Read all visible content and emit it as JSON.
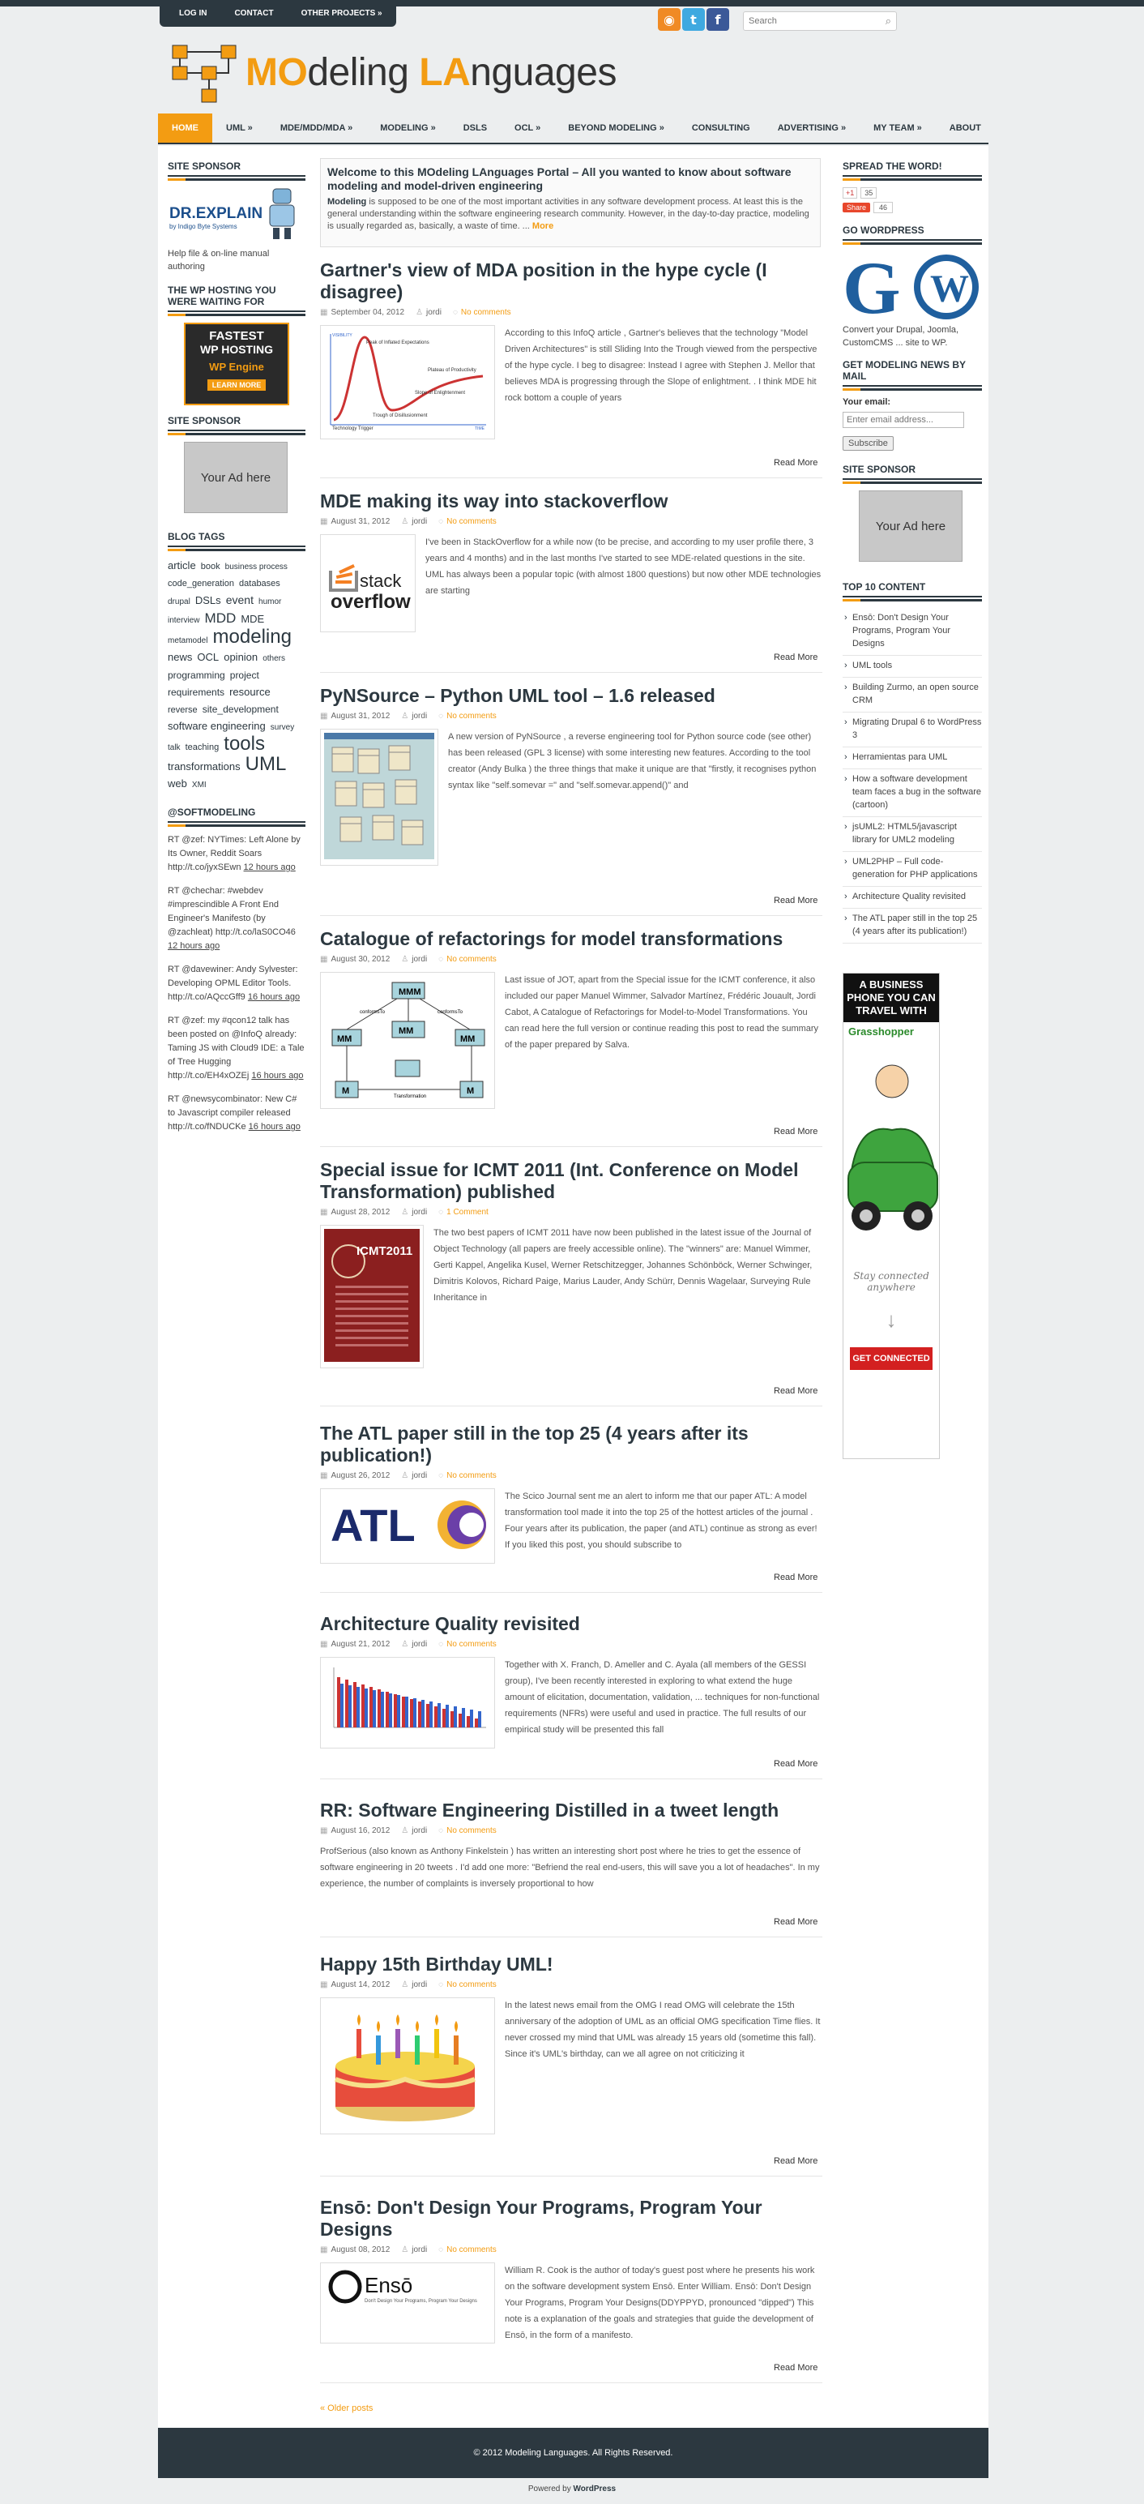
{
  "toplinks": [
    "LOG IN",
    "CONTACT",
    "OTHER PROJECTS »"
  ],
  "search": {
    "placeholder": "Search"
  },
  "logo": {
    "hl1": "MO",
    "rest1": "deling ",
    "hl2": "LA",
    "rest2": "nguages"
  },
  "nav": [
    "HOME",
    "UML »",
    "MDE/MDD/MDA »",
    "MODELING »",
    "DSLS",
    "OCL »",
    "BEYOND MODELING »",
    "CONSULTING",
    "ADVERTISING »",
    "MY TEAM »",
    "ABOUT"
  ],
  "left": {
    "sponsor_title": "SITE SPONSOR",
    "drexplain_name": "DR.EXPLAIN",
    "drexplain_by": "by Indigo Byte Systems",
    "drexplain_text": "Help file & on-line manual authoring",
    "wphosting_title": "THE WP HOSTING YOU WERE WAITING FOR",
    "wpengine_lines": [
      "FASTEST",
      "WP HOSTING",
      "WP Engine",
      "LEARN MORE"
    ],
    "sponsor2_title": "SITE SPONSOR",
    "ad_text": "Your Ad here",
    "tags_title": "BLOG TAGS",
    "tags": [
      {
        "t": "article",
        "s": 13
      },
      {
        "t": "book",
        "s": 11
      },
      {
        "t": "business process",
        "s": 10
      },
      {
        "t": "code_generation",
        "s": 11
      },
      {
        "t": "databases",
        "s": 11
      },
      {
        "t": "drupal",
        "s": 10
      },
      {
        "t": "DSLs",
        "s": 13
      },
      {
        "t": "event",
        "s": 14
      },
      {
        "t": "humor",
        "s": 10
      },
      {
        "t": "interview",
        "s": 10
      },
      {
        "t": "MDD",
        "s": 17
      },
      {
        "t": "MDE",
        "s": 13
      },
      {
        "t": "metamodel",
        "s": 10
      },
      {
        "t": "modeling",
        "s": 24
      },
      {
        "t": "news",
        "s": 13
      },
      {
        "t": "OCL",
        "s": 13
      },
      {
        "t": "opinion",
        "s": 13
      },
      {
        "t": "others",
        "s": 10
      },
      {
        "t": "programming",
        "s": 12
      },
      {
        "t": "project",
        "s": 12
      },
      {
        "t": "requirements",
        "s": 12
      },
      {
        "t": "resource",
        "s": 13
      },
      {
        "t": "reverse",
        "s": 11
      },
      {
        "t": "site_development",
        "s": 12
      },
      {
        "t": "software engineering",
        "s": 13
      },
      {
        "t": "survey",
        "s": 10
      },
      {
        "t": "talk",
        "s": 10
      },
      {
        "t": "teaching",
        "s": 11
      },
      {
        "t": "tools",
        "s": 24
      },
      {
        "t": "transformations",
        "s": 13
      },
      {
        "t": "UML",
        "s": 24
      },
      {
        "t": "web",
        "s": 13
      },
      {
        "t": "XMI",
        "s": 10
      }
    ],
    "tweets_title": "@SOFTMODELING",
    "tweets": [
      {
        "text": "RT @zef: NYTimes: Left Alone by Its Owner, Reddit Soars http://t.co/jyxSEwn ",
        "time": "12 hours ago"
      },
      {
        "text": "RT @chechar: #webdev #imprescindible A Front End Engineer's Manifesto (by @zachleat) http://t.co/laS0CO46 ",
        "time": "12 hours ago"
      },
      {
        "text": "RT @davewiner: Andy Sylvester: Developing OPML Editor Tools. http://t.co/AQccGff9 ",
        "time": "16 hours ago"
      },
      {
        "text": "RT @zef: my #qcon12 talk has been posted on @InfoQ already: Taming JS with Cloud9 IDE: a Tale of Tree Hugging http://t.co/EH4xOZEj ",
        "time": "16 hours ago"
      },
      {
        "text": "RT @newsycombinator: New C# to Javascript compiler released http://t.co/fNDUCKe ",
        "time": "16 hours ago"
      }
    ]
  },
  "welcome": {
    "title": "Welcome to this MOdeling LAnguages Portal – All you wanted to know about software modeling and model-driven engineering",
    "lead": "Modeling",
    "text": " is supposed to be one of the most important activities in any software development process. At least this is the general understanding within the software engineering research community. However, in the day-to-day practice, modeling is usually regarded as, basically, a waste of time. ... ",
    "more": "More"
  },
  "posts": [
    {
      "title": "Gartner's view of MDA position in the hype cycle (I disagree)",
      "date": "September 04, 2012",
      "author": "jordi",
      "comments": "No comments",
      "text": "According to this InfoQ article , Gartner's believes that the technology \"Model Driven Architectures\" is still Sliding Into the Trough viewed from the perspective of the hype cycle. I beg to disagree: Instead I agree with Stephen J. Mellor that believes MDA is progressing through the Slope of enlightment. . I think MDE hit rock bottom a couple of years",
      "read": "Read More",
      "thumb_labels": [
        "VISIBILITY",
        "Peak of Inflated Expectations",
        "Plateau of Productivity",
        "Slope of Enlightenment",
        "Trough of Disillusionment",
        "Technology Trigger",
        "TIME"
      ]
    },
    {
      "title": "MDE making its way into stackoverflow",
      "date": "August 31, 2012",
      "author": "jordi",
      "comments": "No comments",
      "text": "I've been in StackOverflow for a while now (to be precise, and according to my user profile there, 3 years and 4 months) and in the last months I've started to see MDE-related questions in the site. UML has always been a popular topic (with almost 1800 questions) but now other MDE technologies are starting",
      "read": "Read More",
      "thumb_labels": [
        "stack",
        "overflow"
      ]
    },
    {
      "title": "PyNSource – Python UML tool – 1.6 released",
      "date": "August 31, 2012",
      "author": "jordi",
      "comments": "No comments",
      "text": "A new version of PyNSource , a reverse engineering tool for Python source code (see other) has been released (GPL 3 license) with some interesting new features. According to the tool creator (Andy Bulka ) the three things that make it unique are that \"firstly, it recognises python syntax like \"self.somevar =\" and \"self.somevar.append()\" and",
      "read": "Read More",
      "thumb_labels": []
    },
    {
      "title": "Catalogue of refactorings for model transformations",
      "date": "August 30, 2012",
      "author": "jordi",
      "comments": "No comments",
      "text": "Last issue of JOT, apart from the Special issue for the ICMT conference, it also included our paper Manuel Wimmer, Salvador Martínez, Frédéric Jouault, Jordi Cabot, A Catalogue of Refactorings for Model-to-Model Transformations. You can read here the full version or continue reading this post to read the summary of the paper prepared by Salva.",
      "read": "Read More",
      "thumb_labels": [
        "MMM",
        "MM",
        "MM",
        "MM",
        "M",
        "M",
        "conformsTo",
        "conformsTo",
        "Transformation"
      ]
    },
    {
      "title": "Special issue for ICMT 2011 (Int. Conference on Model Transformation) published",
      "date": "August 28, 2012",
      "author": "jordi",
      "comments": "1 Comment",
      "text": "The two best papers of ICMT 2011 have now been published in the latest issue of the Journal of Object Technology (all papers are freely accessible online). The \"winners\" are: Manuel Wimmer, Gerti Kappel, Angelika Kusel, Werner Retschitzegger, Johannes Schönböck, Werner Schwinger, Dimitris Kolovos, Richard Paige, Marius Lauder, Andy Schürr, Dennis Wagelaar, Surveying Rule Inheritance in",
      "read": "Read More",
      "thumb_labels": [
        "ICMT2011"
      ]
    },
    {
      "title": "The ATL paper still in the top 25 (4 years after its publication!)",
      "date": "August 26, 2012",
      "author": "jordi",
      "comments": "No comments",
      "text": "The Scico Journal sent me an alert to inform me that our paper ATL: A model transformation tool made it into the top 25 of the hottest articles of the journal . Four years after its publication, the paper (and ATL) continue as strong as ever! If you liked this post, you should subscribe to",
      "read": "Read More",
      "thumb_labels": [
        "ATL"
      ]
    },
    {
      "title": "Architecture Quality revisited",
      "date": "August 21, 2012",
      "author": "jordi",
      "comments": "No comments",
      "text": "Together with X. Franch, D. Ameller and C. Ayala (all members of the GESSI group), I've been recently interested in exploring to what extend the huge amount of elicitation, documentation, validation, ... techniques for non-functional requirements (NFRs) were useful and used in practice. The full results of our empirical study will be presented this fall",
      "read": "Read More",
      "thumb_labels": []
    },
    {
      "title": "RR: Software Engineering Distilled in a tweet length",
      "date": "August 16, 2012",
      "author": "jordi",
      "comments": "No comments",
      "text": "ProfSerious (also known as Anthony Finkelstein ) has written an interesting short post where he tries to get the essence of software engineering in 20 tweets . I'd add one more: \"Befriend the real end-users, this will save you a lot of headaches\". In my experience, the number of complaints is inversely proportional to how",
      "read": "Read More",
      "thumb_labels": []
    },
    {
      "title": "Happy 15th Birthday UML!",
      "date": "August 14, 2012",
      "author": "jordi",
      "comments": "No comments",
      "text": "In the latest news email from the OMG I read OMG will celebrate the 15th anniversary of the adoption of UML as an official OMG specification Time flies. It never crossed my mind that UML was already 15 years old (sometime this fall). Since it's UML's birthday, can we all agree on not criticizing it",
      "read": "Read More",
      "thumb_labels": []
    },
    {
      "title": "Ensō: Don't Design Your Programs, Program Your Designs",
      "date": "August 08, 2012",
      "author": "jordi",
      "comments": "No comments",
      "text": "William R. Cook is the author of today's guest post where he presents his work on the software development system Ensō. Enter William. Ensō: Don't Design Your Programs, Program Your Designs(DDYPPYD, pronounced \"dipped\") This note is a explanation of the goals and strategies that guide the development of Ensō, in the form of a manifesto.",
      "read": "Read More",
      "thumb_labels": [
        "Ensō",
        "Don't Design Your Programs, Program Your Designs"
      ]
    }
  ],
  "older": "« Older posts",
  "right": {
    "spread_title": "SPREAD THE WORD!",
    "gplus_count": "35",
    "share_label": "Share",
    "share_count": "46",
    "gowp_title": "GO WORDPRESS",
    "gowp_text": "Convert your Drupal, Joomla, CustomCMS ... site to WP.",
    "email_title": "GET MODELING NEWS BY MAIL",
    "email_label": "Your email:",
    "email_placeholder": "Enter email address...",
    "subscribe": "Subscribe",
    "sponsor_title": "SITE SPONSOR",
    "ad_text": "Your Ad here",
    "top10_title": "TOP 10 CONTENT",
    "top10": [
      "Ensō: Don't Design Your Programs, Program Your Designs",
      "UML tools",
      "Building Zurmo, an open source CRM",
      "Migrating Drupal 6 to WordPress 3",
      "Herramientas para UML",
      "How a software development team faces a bug in the software (cartoon)",
      "jsUML2: HTML5/javascript library for UML2 modeling",
      "UML2PHP – Full code-generation for PHP applications",
      "Architecture Quality revisited",
      "The ATL paper still in the top 25 (4 years after its publication!)"
    ],
    "gh_lines": [
      "A BUSINESS",
      "PHONE YOU CAN",
      "TRAVEL WITH",
      "Grasshopper",
      "Stay connected",
      "anywhere",
      "GET CONNECTED"
    ]
  },
  "footer": "© 2012 Modeling Languages. All Rights Reserved.",
  "powered": {
    "pre": "Powered by ",
    "name": "WordPress"
  },
  "colors": {
    "accent": "#f39c12",
    "dark": "#2c3840"
  }
}
